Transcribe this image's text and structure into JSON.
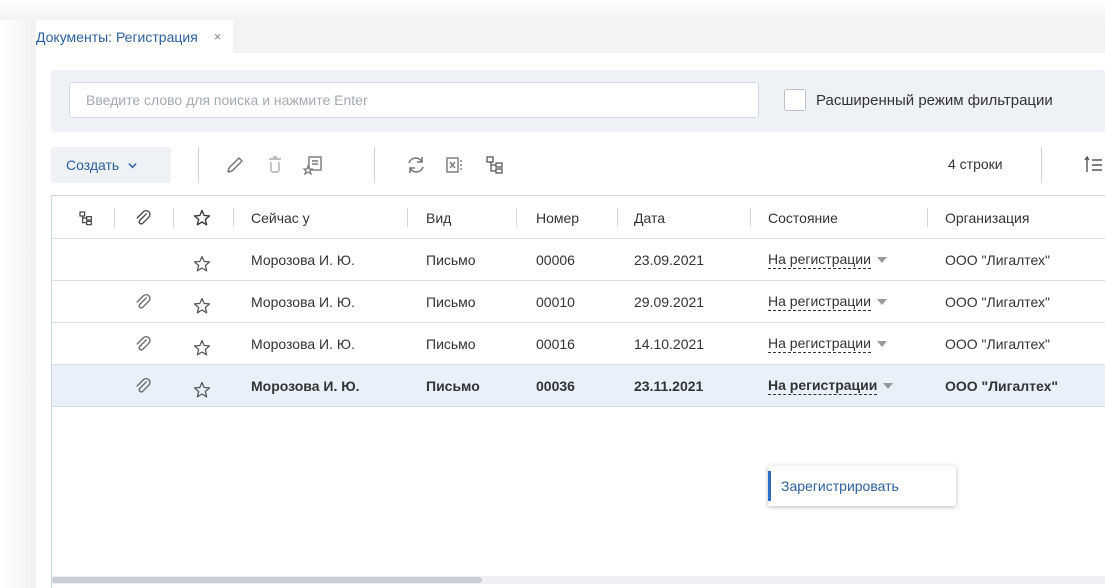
{
  "tab": {
    "title": "Документы: Регистрация",
    "close": "×"
  },
  "search": {
    "placeholder": "Введите слово для поиска и нажмите Enter",
    "value": ""
  },
  "filter": {
    "advanced_label": "Расширенный режим фильтрации",
    "advanced_checked": false
  },
  "toolbar": {
    "create_label": "Создать",
    "icons": [
      "edit-icon",
      "delete-icon",
      "favorite-list-icon",
      "refresh-icon",
      "excel-export-icon",
      "hierarchy-icon",
      "sort-lines-icon"
    ],
    "row_count": "4 строки"
  },
  "columns": {
    "hierarchy": "hierarchy-icon",
    "attachment": "paperclip-icon",
    "favorite": "star-icon",
    "owner": "Сейчас у",
    "kind": "Вид",
    "number": "Номер",
    "date": "Дата",
    "state": "Состояние",
    "org": "Организация"
  },
  "rows": [
    {
      "attachment": false,
      "owner": "Морозова И. Ю.",
      "kind": "Письмо",
      "number": "00006",
      "date": "23.09.2021",
      "state": "На регистрации",
      "org": "ООО \"Лигалтех\"",
      "selected": false
    },
    {
      "attachment": true,
      "owner": "Морозова И. Ю.",
      "kind": "Письмо",
      "number": "00010",
      "date": "29.09.2021",
      "state": "На регистрации",
      "org": "ООО \"Лигалтех\"",
      "selected": false
    },
    {
      "attachment": true,
      "owner": "Морозова И. Ю.",
      "kind": "Письмо",
      "number": "00016",
      "date": "14.10.2021",
      "state": "На регистрации",
      "org": "ООО \"Лигалтех\"",
      "selected": false
    },
    {
      "attachment": true,
      "owner": "Морозова И. Ю.",
      "kind": "Письмо",
      "number": "00036",
      "date": "23.11.2021",
      "state": "На регистрации",
      "org": "ООО \"Лигалтех\"",
      "selected": true
    }
  ],
  "state_menu": {
    "items": [
      "Зарегистрировать"
    ]
  },
  "colors": {
    "accent": "#2b5f9e",
    "selected_row": "#e8f0f9",
    "panel": "#eef1f5"
  }
}
